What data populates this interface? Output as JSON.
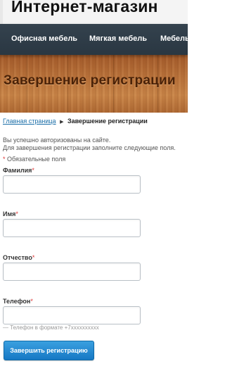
{
  "header": {
    "store_title": "Интернет-магазин"
  },
  "nav": {
    "items": [
      {
        "label": "Офисная мебель"
      },
      {
        "label": "Мягкая мебель"
      },
      {
        "label": "Мебель"
      }
    ]
  },
  "banner": {
    "heading": "Завершение регистрации"
  },
  "breadcrumb": {
    "home_label": "Главная страница",
    "current_label": "Завершение регистрации"
  },
  "info": {
    "line1": "Вы успешно авторизованы на сайте.",
    "line2": "Для завершения регистрации заполните следующие поля."
  },
  "form": {
    "required_marker": "*",
    "required_note": "Обязательные поля",
    "fields": [
      {
        "label": "Фамилия",
        "value": ""
      },
      {
        "label": "Имя",
        "value": ""
      },
      {
        "label": "Отчество",
        "value": ""
      },
      {
        "label": "Телефон",
        "value": ""
      }
    ],
    "phone_hint": "— Телефон в формате +7xxxxxxxxxx",
    "submit_label": "Завершить регистрацию"
  },
  "colors": {
    "nav_background": "#2f3c47",
    "heading": "#4a2208",
    "link": "#1a6ea8",
    "required_star": "#dd3333",
    "button": "#1f86d0"
  }
}
